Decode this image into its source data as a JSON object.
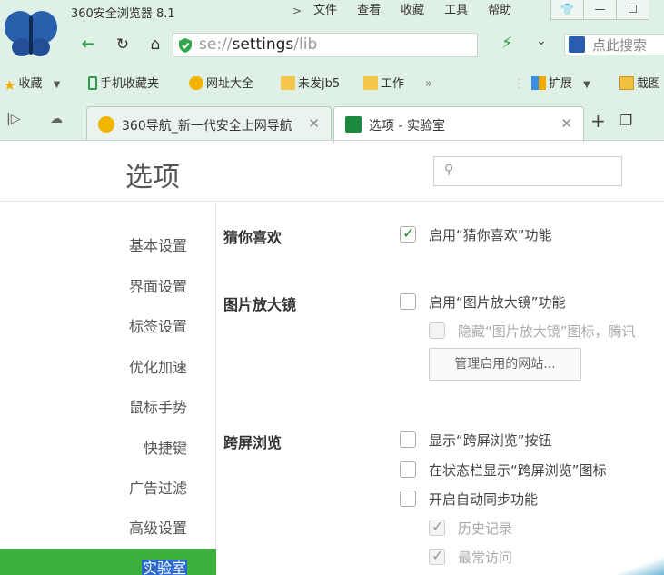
{
  "app": {
    "title": "360安全浏览器 8.1"
  },
  "menu": {
    "arrow": ">",
    "items": [
      "文件",
      "查看",
      "收藏",
      "工具",
      "帮助"
    ]
  },
  "window_buttons": [
    "👕",
    "—",
    "☐"
  ],
  "address": {
    "url_prefix": "se://",
    "url_main": "settings",
    "url_suffix": "/lib",
    "search_placeholder": "点此搜索"
  },
  "bookmarks": [
    {
      "label": "收藏",
      "icon": "star-icon",
      "dropdown": true
    },
    {
      "label": "手机收藏夹",
      "icon": "phone-icon"
    },
    {
      "label": "网址大全",
      "icon": "site-icon"
    },
    {
      "label": "未发jb5",
      "icon": "folder-icon"
    },
    {
      "label": "工作",
      "icon": "folder-icon"
    }
  ],
  "bookmarks_more": "»",
  "extensions": {
    "label": "扩展",
    "screenshot_label": "截图"
  },
  "tabs": [
    {
      "label": "360导航_新一代安全上网导航",
      "active": false
    },
    {
      "label": "选项 - 实验室",
      "active": true
    }
  ],
  "page": {
    "title": "选项",
    "search_placeholder": ""
  },
  "sidebar": {
    "items": [
      {
        "label": "基本设置"
      },
      {
        "label": "界面设置"
      },
      {
        "label": "标签设置"
      },
      {
        "label": "优化加速"
      },
      {
        "label": "鼠标手势"
      },
      {
        "label": "快捷键"
      },
      {
        "label": "广告过滤"
      },
      {
        "label": "高级设置"
      },
      {
        "label": "实验室",
        "active": true
      }
    ]
  },
  "sections": {
    "guess": {
      "title": "猜你喜欢",
      "options": [
        {
          "label": "启用“猜你喜欢”功能",
          "checked": true,
          "disabled": false
        }
      ]
    },
    "magnifier": {
      "title": "图片放大镜",
      "options": [
        {
          "label": "启用“图片放大镜”功能",
          "checked": false,
          "disabled": false
        },
        {
          "label": "隐藏“图片放大镜”图标，腾讯",
          "checked": false,
          "disabled": true
        }
      ],
      "manage_button": "管理启用的网站..."
    },
    "crossscreen": {
      "title": "跨屏浏览",
      "options": [
        {
          "label": "显示“跨屏浏览”按钮",
          "checked": false,
          "disabled": false
        },
        {
          "label": "在状态栏显示“跨屏浏览”图标",
          "checked": false,
          "disabled": false
        },
        {
          "label": "开启自动同步功能",
          "checked": false,
          "disabled": false
        },
        {
          "label": "历史记录",
          "checked": true,
          "disabled": true
        },
        {
          "label": "最常访问",
          "checked": true,
          "disabled": true
        }
      ]
    }
  }
}
